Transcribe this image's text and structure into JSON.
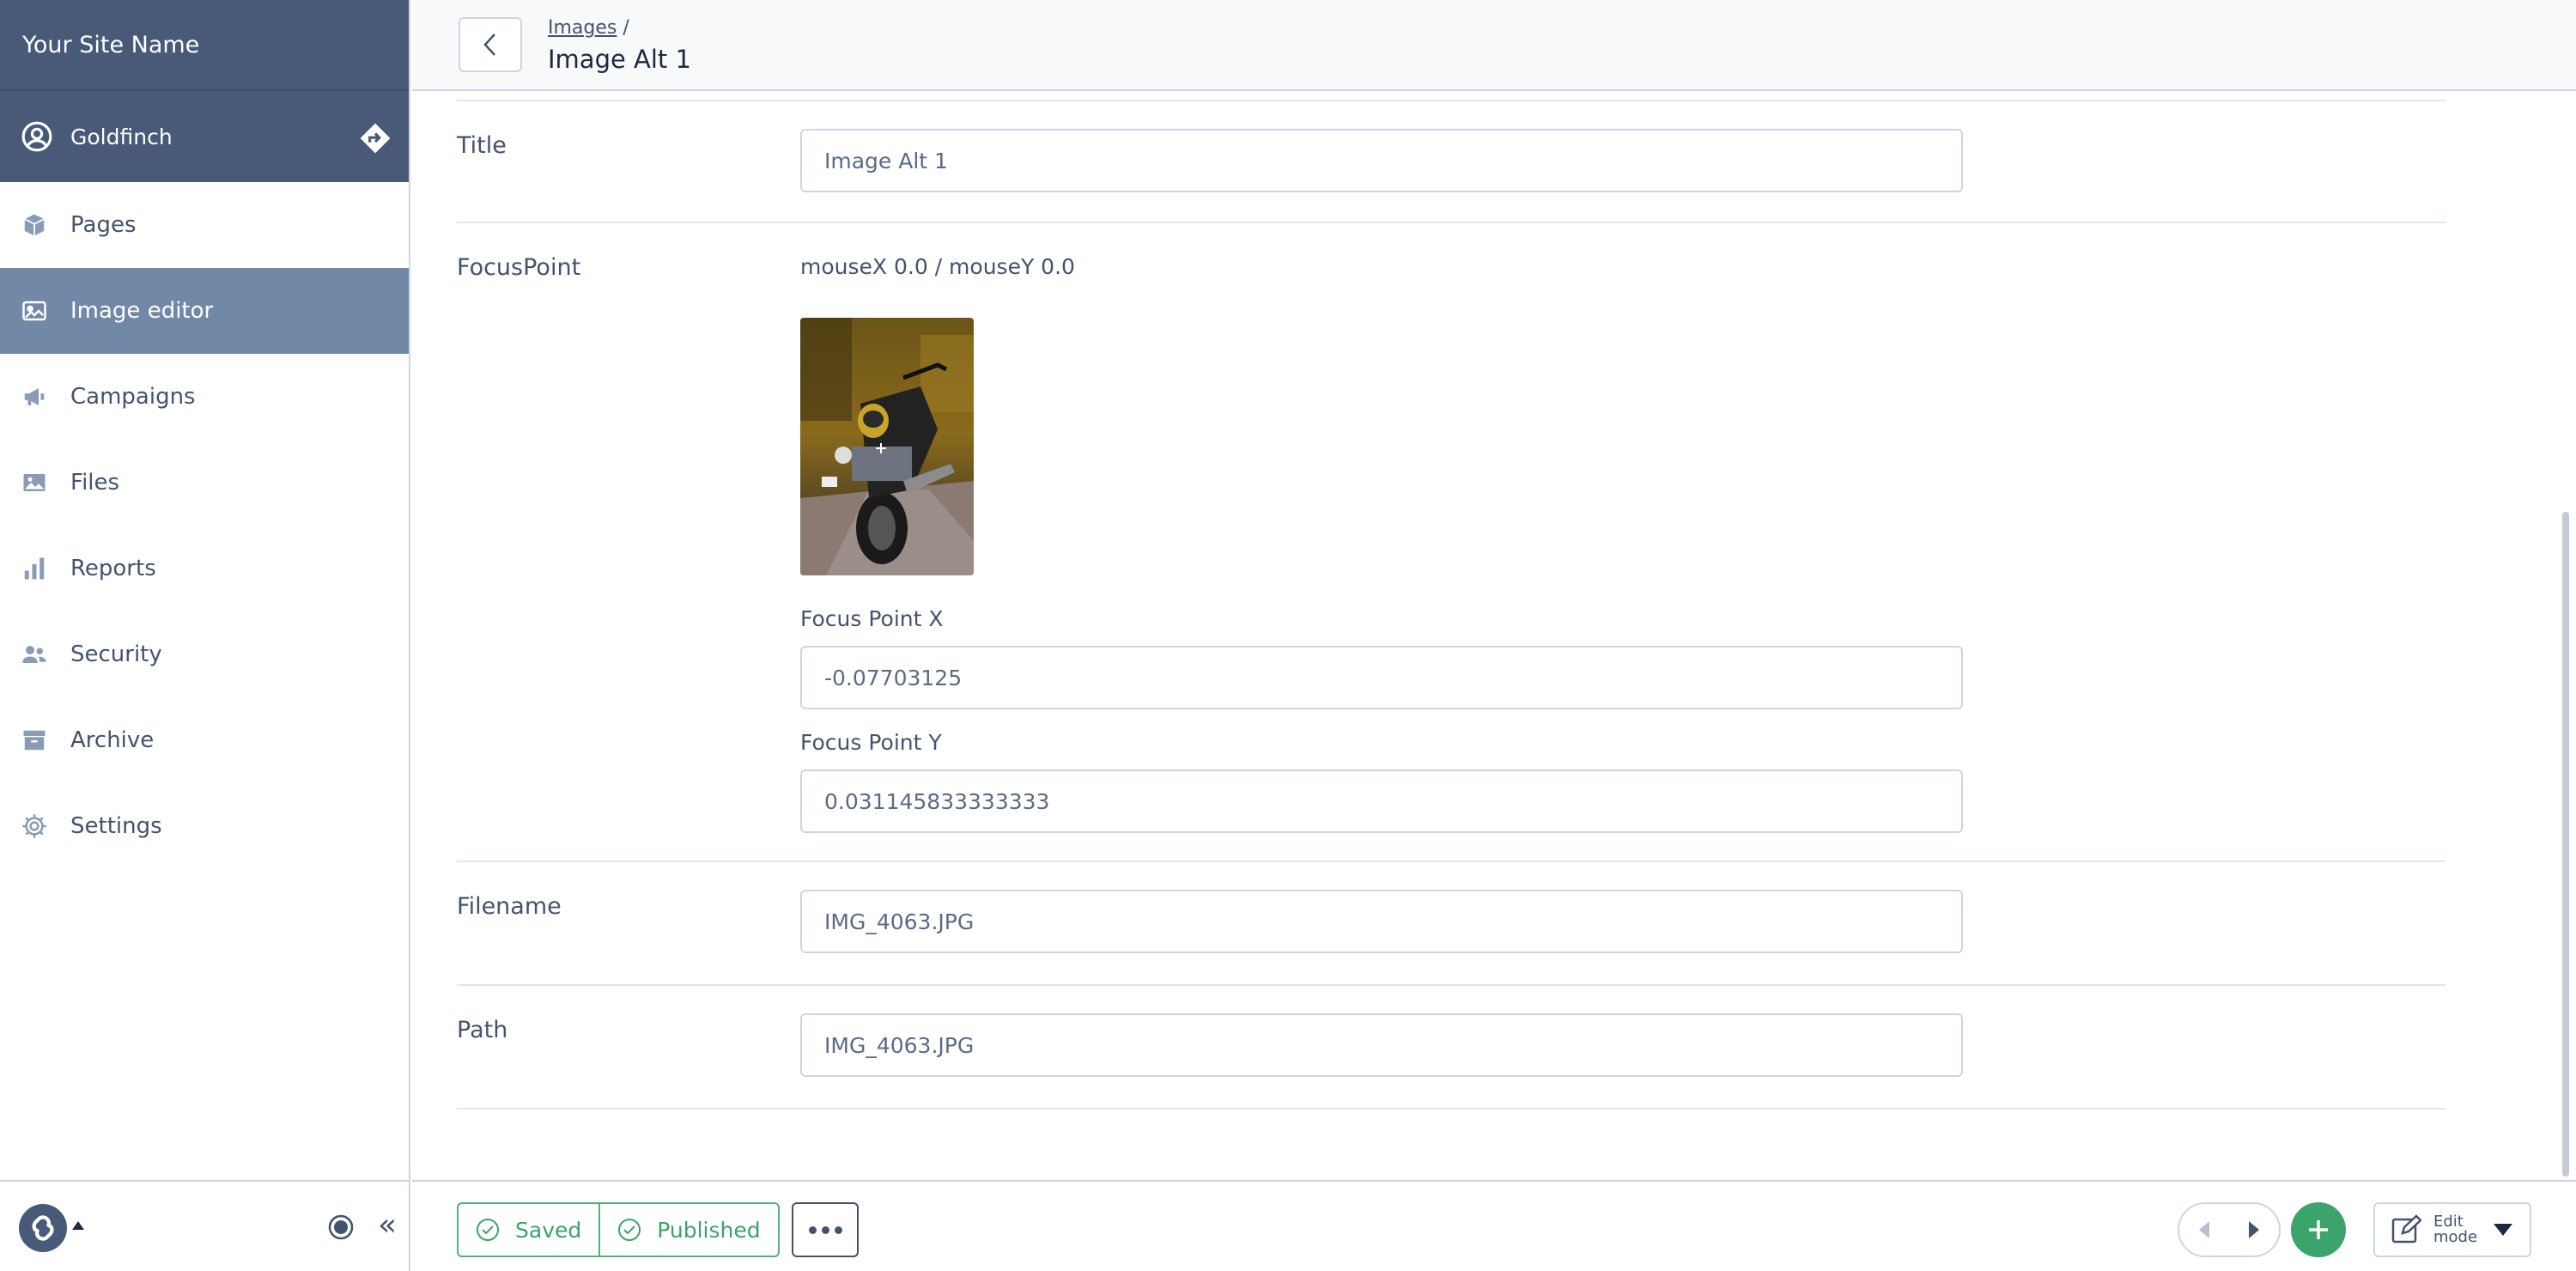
{
  "sidebar": {
    "site_name": "Your Site Name",
    "user_name": "Goldfinch",
    "items": [
      {
        "label": "Pages",
        "icon": "cube-icon"
      },
      {
        "label": "Image editor",
        "icon": "image-icon",
        "active": true
      },
      {
        "label": "Campaigns",
        "icon": "megaphone-icon"
      },
      {
        "label": "Files",
        "icon": "picture-icon"
      },
      {
        "label": "Reports",
        "icon": "bar-chart-icon"
      },
      {
        "label": "Security",
        "icon": "users-icon"
      },
      {
        "label": "Archive",
        "icon": "archive-box-icon"
      },
      {
        "label": "Settings",
        "icon": "gear-icon"
      }
    ],
    "collapse_label": "«"
  },
  "header": {
    "breadcrumb_link": "Images",
    "breadcrumb_sep": "/",
    "title": "Image Alt 1"
  },
  "form": {
    "title_label": "Title",
    "title_value": "Image Alt 1",
    "focus_label": "FocusPoint",
    "mouse_readout": "mouseX 0.0 / mouseY 0.0",
    "focus_x_label": "Focus Point X",
    "focus_x_value": "-0.07703125",
    "focus_y_label": "Focus Point Y",
    "focus_y_value": "0.031145833333333",
    "filename_label": "Filename",
    "filename_value": "IMG_4063.JPG",
    "path_label": "Path",
    "path_value": "IMG_4063.JPG"
  },
  "footer": {
    "saved_label": "Saved",
    "published_label": "Published",
    "edit_mode_label": "Edit mode"
  },
  "colors": {
    "sidebar_header": "#485a78",
    "active_nav": "#7288a7",
    "success": "#3aa46a"
  }
}
